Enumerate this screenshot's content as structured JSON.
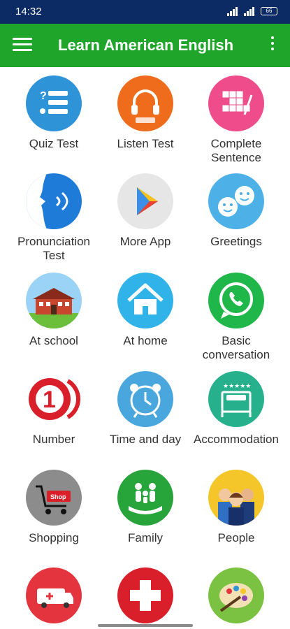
{
  "status": {
    "time": "14:32",
    "battery": "66"
  },
  "appbar": {
    "title": "Learn American English"
  },
  "tiles": [
    {
      "label": "Quiz Test",
      "icon": "quiz-list-icon",
      "color": "#2f93d8"
    },
    {
      "label": "Listen Test",
      "icon": "headphones-icon",
      "color": "#ef6c1c"
    },
    {
      "label": "Complete Sentence",
      "icon": "crossword-icon",
      "color": "#ee4c8a"
    },
    {
      "label": "Pronunciation Test",
      "icon": "speaking-face-icon",
      "color": "#1f7bd8"
    },
    {
      "label": "More App",
      "icon": "play-store-icon",
      "color": "#e6e6e6"
    },
    {
      "label": "Greetings",
      "icon": "smiley-chat-icon",
      "color": "#4db1e8"
    },
    {
      "label": "At school",
      "icon": "school-building-icon",
      "color": "#9ad3f5"
    },
    {
      "label": "At home",
      "icon": "house-icon",
      "color": "#2fb3e8"
    },
    {
      "label": "Basic conversation",
      "icon": "phone-chat-icon",
      "color": "#1fb74a"
    },
    {
      "label": "Number",
      "icon": "number-one-icon",
      "color": "#d81f2a"
    },
    {
      "label": "Time and day",
      "icon": "alarm-clock-icon",
      "color": "#4aa7dd"
    },
    {
      "label": "Accommodation",
      "icon": "hotel-bed-icon",
      "color": "#26b08c"
    },
    {
      "label": "Shopping",
      "icon": "shopping-cart-icon",
      "color": "#8c8c8c"
    },
    {
      "label": "Family",
      "icon": "family-hand-icon",
      "color": "#27a53a"
    },
    {
      "label": "People",
      "icon": "people-group-icon",
      "color": "#f4c62a"
    },
    {
      "label": "",
      "icon": "ambulance-icon",
      "color": "#e4353e"
    },
    {
      "label": "",
      "icon": "medical-cross-icon",
      "color": "#d81f2a"
    },
    {
      "label": "",
      "icon": "art-palette-icon",
      "color": "#7cc242"
    }
  ]
}
